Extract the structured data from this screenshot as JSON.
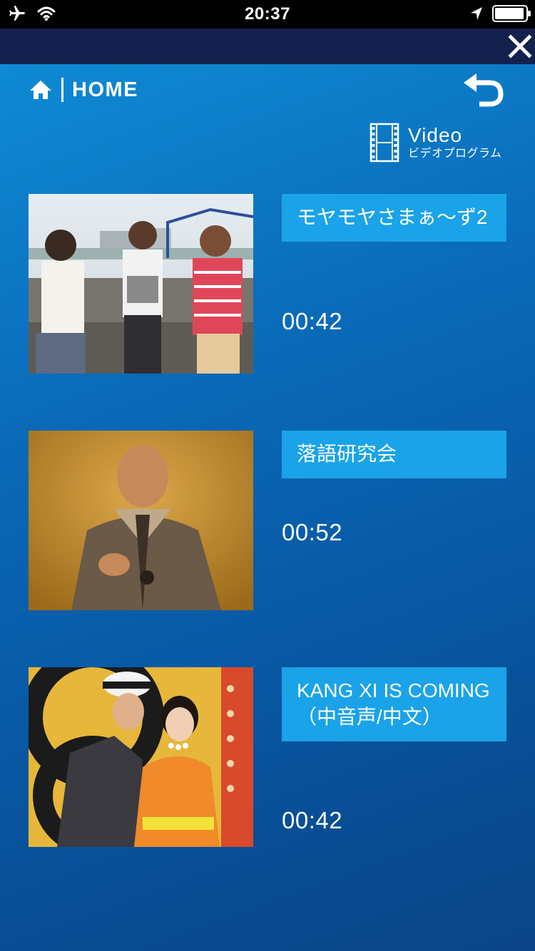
{
  "status_bar": {
    "time": "20:37"
  },
  "nav": {
    "home_label": "HOME"
  },
  "section": {
    "title": "Video",
    "subtitle": "ビデオプログラム"
  },
  "videos": [
    {
      "title": "モヤモヤさまぁ〜ず2",
      "duration": "00:42"
    },
    {
      "title": "落語研究会",
      "duration": "00:52"
    },
    {
      "title": "KANG XI IS COMING（中音声/中文）",
      "duration": "00:42"
    }
  ],
  "colors": {
    "status_bar": "#000000",
    "top_bar": "#14214f",
    "background_top": "#0f8ad4",
    "background_bottom": "#0a4486",
    "title_button": "#1aa3e8",
    "text": "#ffffff"
  }
}
